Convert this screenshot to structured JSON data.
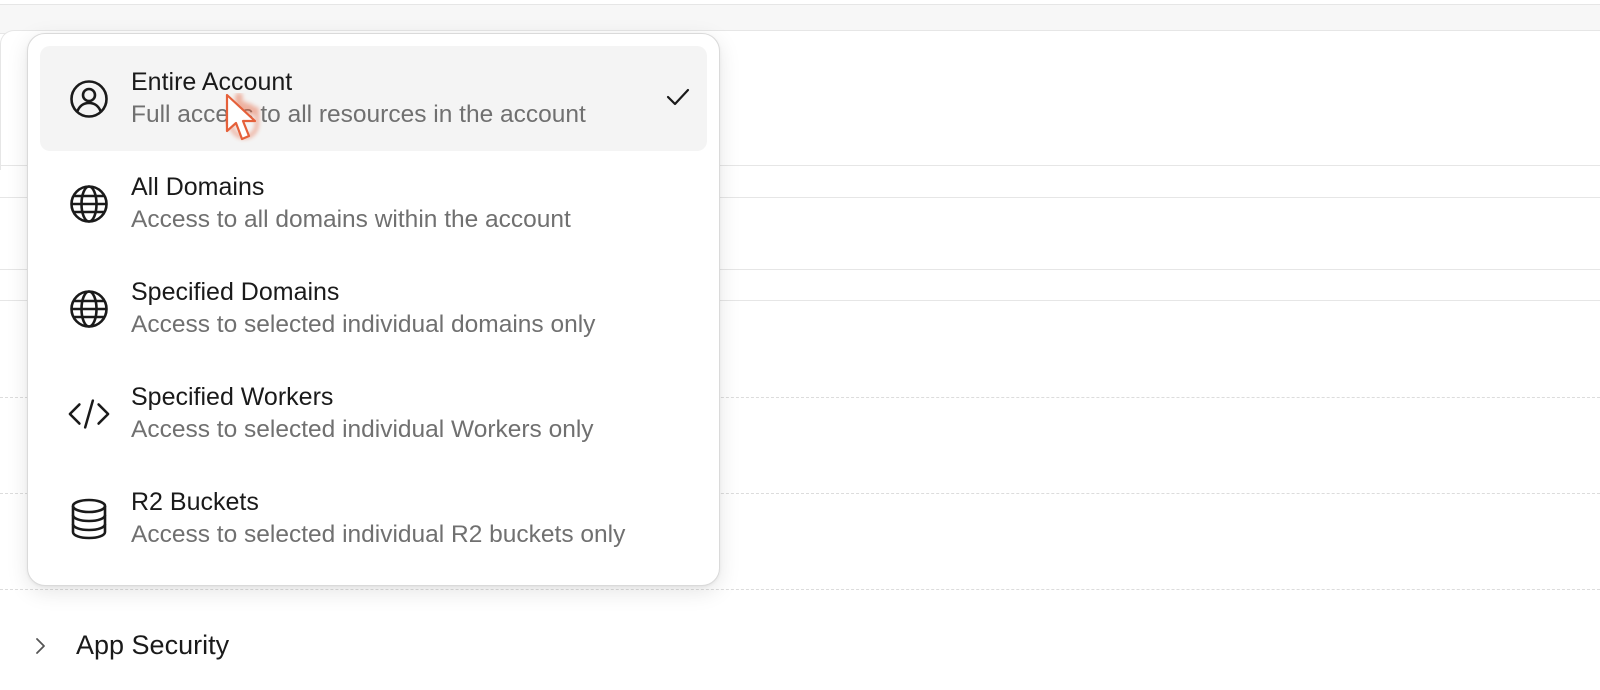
{
  "dropdown": {
    "options": [
      {
        "title": "Entire Account",
        "description": "Full access to all resources in the account",
        "icon": "user-circle-icon",
        "selected": true
      },
      {
        "title": "All Domains",
        "description": "Access to all domains within the account",
        "icon": "globe-icon",
        "selected": false
      },
      {
        "title": "Specified Domains",
        "description": "Access to selected individual domains only",
        "icon": "globe-icon",
        "selected": false
      },
      {
        "title": "Specified Workers",
        "description": "Access to selected individual Workers only",
        "icon": "code-icon",
        "selected": false
      },
      {
        "title": "R2 Buckets",
        "description": "Access to selected individual R2 buckets only",
        "icon": "database-icon",
        "selected": false
      }
    ]
  },
  "background": {
    "section_label": "App Security"
  },
  "colors": {
    "selected_bg": "#f4f4f4",
    "cursor": "#e5603a"
  }
}
